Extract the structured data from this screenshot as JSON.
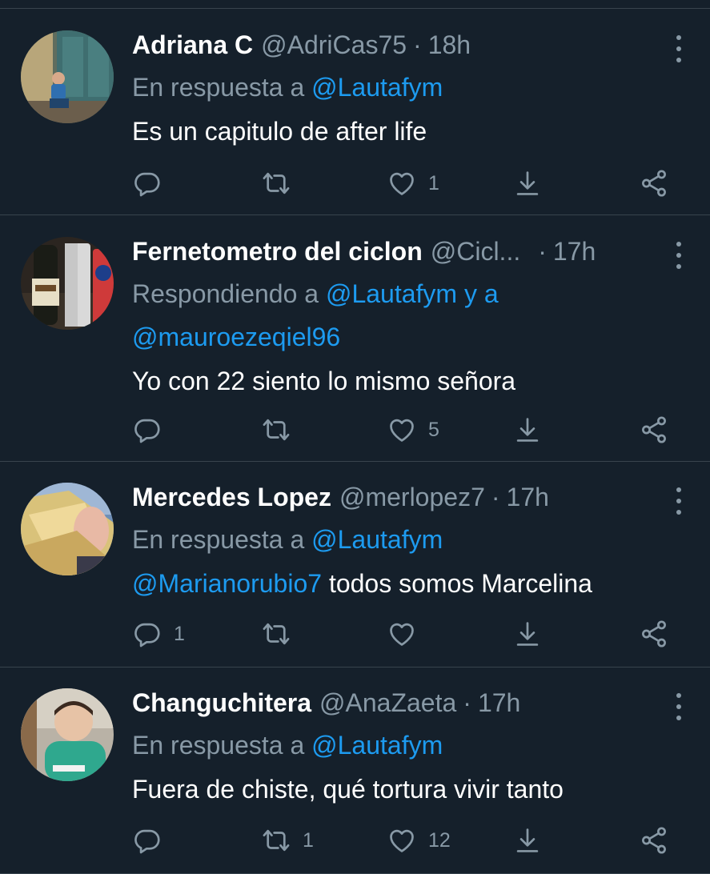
{
  "colors": {
    "background": "#15202b",
    "divider": "#38444d",
    "secondary_text": "#8899a6",
    "link": "#1d9bf0"
  },
  "icons": {
    "reply": "reply-icon",
    "retweet": "retweet-icon",
    "like": "heart-icon",
    "bookmark": "bookmark-icon",
    "share": "share-icon",
    "more": "more-icon"
  },
  "tweets": [
    {
      "name": "Adriana C",
      "handle": "@AdriCas75",
      "separator": "·",
      "time": "18h",
      "reply_prefix": "En respuesta a",
      "reply_mention": "@Lautafym",
      "reply_mid": "",
      "reply_mention_2": "",
      "text_mention": "",
      "text": "Es un capitulo de after life",
      "reply_count": "",
      "retweet_count": "",
      "like_count": "1"
    },
    {
      "name": "Fernetometro del ciclon",
      "handle": "@Cicl...",
      "separator": "·",
      "time": "17h",
      "reply_prefix": "Respondiendo a",
      "reply_mention": "@Lautafym",
      "reply_mid": "y a",
      "reply_mention_2": "@mauroezeqiel96",
      "text_mention": "",
      "text": "Yo con 22 siento lo mismo señora",
      "reply_count": "",
      "retweet_count": "",
      "like_count": "5"
    },
    {
      "name": "Mercedes Lopez",
      "handle": "@merlopez7",
      "separator": "·",
      "time": "17h",
      "reply_prefix": "En respuesta a",
      "reply_mention": "@Lautafym",
      "reply_mid": "",
      "reply_mention_2": "",
      "text_mention": "@Marianorubio7",
      "text": "todos somos Marcelina",
      "reply_count": "1",
      "retweet_count": "",
      "like_count": ""
    },
    {
      "name": "Changuchitera",
      "handle": "@AnaZaeta",
      "separator": "·",
      "time": "17h",
      "reply_prefix": "En respuesta a",
      "reply_mention": "@Lautafym",
      "reply_mid": "",
      "reply_mention_2": "",
      "text_mention": "",
      "text": "Fuera de chiste, qué tortura vivir tanto",
      "reply_count": "",
      "retweet_count": "1",
      "like_count": "12"
    }
  ]
}
